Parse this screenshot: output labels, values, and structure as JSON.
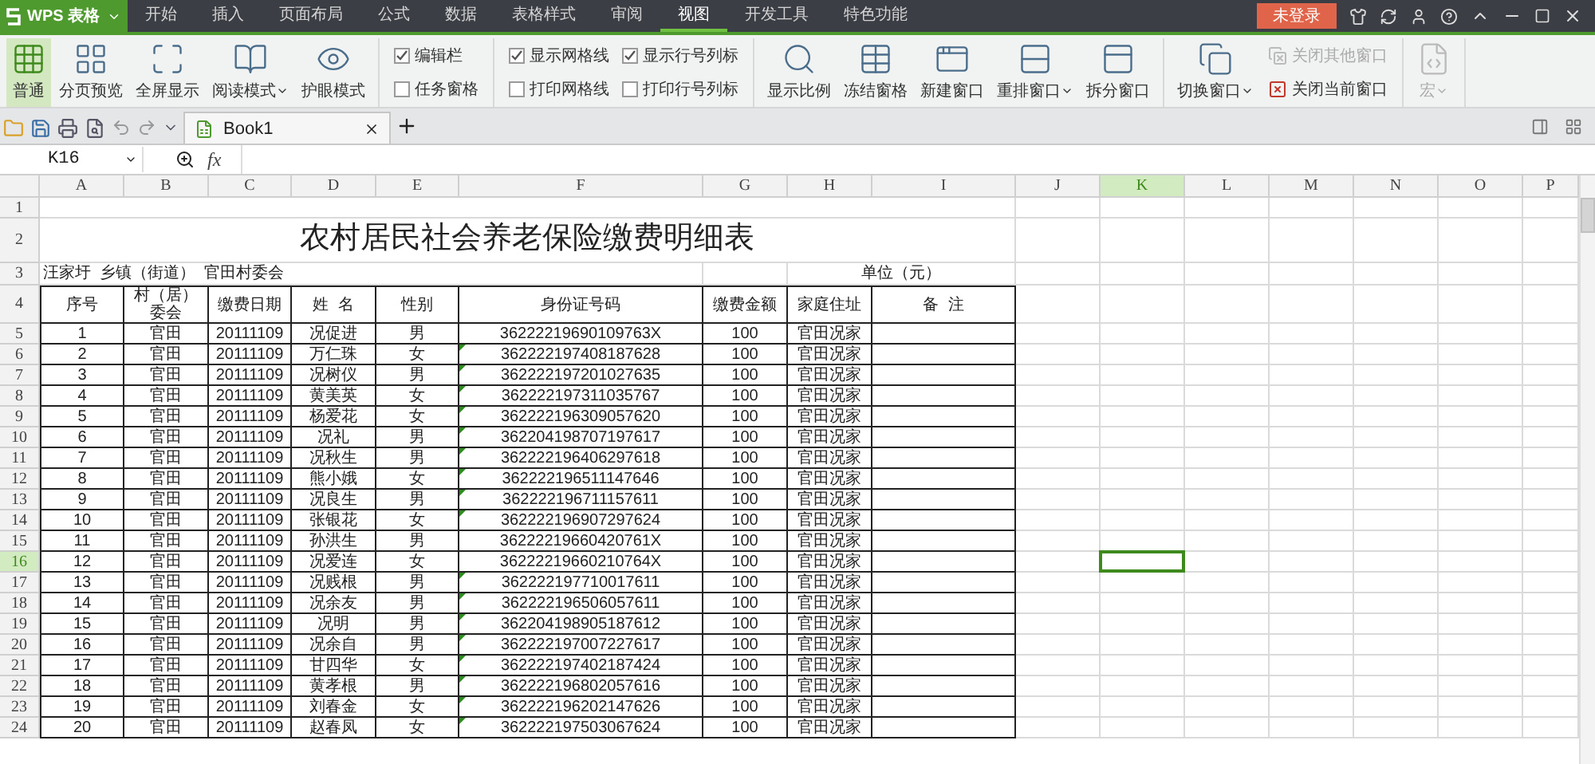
{
  "menu": {
    "app": "WPS 表格",
    "tabs": [
      {
        "label": "开始",
        "selected": false
      },
      {
        "label": "插入",
        "selected": false
      },
      {
        "label": "页面布局",
        "selected": false
      },
      {
        "label": "公式",
        "selected": false
      },
      {
        "label": "数据",
        "selected": false
      },
      {
        "label": "表格样式",
        "selected": false
      },
      {
        "label": "审阅",
        "selected": false
      },
      {
        "label": "视图",
        "selected": true
      },
      {
        "label": "开发工具",
        "selected": false
      },
      {
        "label": "特色功能",
        "selected": false
      }
    ],
    "login": "未登录"
  },
  "ribbon": {
    "groups": [
      {
        "items": [
          {
            "kind": "large",
            "label": "普通",
            "selected": true,
            "dropdown": false,
            "disabled": false
          },
          {
            "kind": "large",
            "label": "分页预览",
            "selected": false,
            "dropdown": false,
            "disabled": false
          },
          {
            "kind": "large",
            "label": "全屏显示",
            "selected": false,
            "dropdown": false,
            "disabled": false
          },
          {
            "kind": "large",
            "label": "阅读模式",
            "selected": false,
            "dropdown": true,
            "disabled": false
          },
          {
            "kind": "large",
            "label": "护眼模式",
            "selected": false,
            "dropdown": false,
            "disabled": false
          }
        ]
      },
      {
        "items": [
          {
            "kind": "check",
            "label": "编辑栏",
            "checked": true
          },
          {
            "kind": "check",
            "label": "任务窗格",
            "checked": false
          }
        ]
      },
      {
        "items": [
          {
            "kind": "check",
            "label": "显示网格线",
            "checked": true
          },
          {
            "kind": "check",
            "label": "打印网格线",
            "checked": false
          },
          {
            "kind": "check",
            "label": "显示行号列标",
            "checked": true
          },
          {
            "kind": "check",
            "label": "打印行号列标",
            "checked": false
          }
        ]
      },
      {
        "items": [
          {
            "kind": "large",
            "label": "显示比例",
            "selected": false,
            "dropdown": false,
            "disabled": false
          },
          {
            "kind": "large",
            "label": "冻结窗格",
            "selected": false,
            "dropdown": false,
            "disabled": false
          },
          {
            "kind": "large",
            "label": "新建窗口",
            "selected": false,
            "dropdown": false,
            "disabled": false
          },
          {
            "kind": "large",
            "label": "重排窗口",
            "selected": false,
            "dropdown": true,
            "disabled": false
          },
          {
            "kind": "large",
            "label": "拆分窗口",
            "selected": false,
            "dropdown": false,
            "disabled": false
          }
        ]
      },
      {
        "items": [
          {
            "kind": "large",
            "label": "切换窗口",
            "selected": false,
            "dropdown": true,
            "disabled": false
          },
          {
            "kind": "small",
            "label": "关闭其他窗口",
            "disabled": true
          },
          {
            "kind": "small",
            "label": "关闭当前窗口",
            "disabled": false
          }
        ]
      },
      {
        "items": [
          {
            "kind": "large",
            "label": "宏",
            "selected": false,
            "dropdown": true,
            "disabled": true
          }
        ]
      }
    ]
  },
  "doc_tabs": [
    {
      "label": "Book1",
      "selected": true
    }
  ],
  "formula_bar": {
    "name_box": "K16",
    "fx": "fx"
  },
  "sheet": {
    "columns": [
      {
        "label": "A",
        "selected": false
      },
      {
        "label": "B",
        "selected": false
      },
      {
        "label": "C",
        "selected": false
      },
      {
        "label": "D",
        "selected": false
      },
      {
        "label": "E",
        "selected": false
      },
      {
        "label": "F",
        "selected": false
      },
      {
        "label": "G",
        "selected": false
      },
      {
        "label": "H",
        "selected": false
      },
      {
        "label": "I",
        "selected": false
      },
      {
        "label": "J",
        "selected": false
      },
      {
        "label": "K",
        "selected": true
      },
      {
        "label": "L",
        "selected": false
      },
      {
        "label": "M",
        "selected": false
      },
      {
        "label": "N",
        "selected": false
      },
      {
        "label": "O",
        "selected": false
      },
      {
        "label": "P",
        "selected": false
      }
    ],
    "row_numbers": [
      {
        "label": "1",
        "selected": false
      },
      {
        "label": "2",
        "selected": false
      },
      {
        "label": "3",
        "selected": false
      },
      {
        "label": "4",
        "selected": false
      },
      {
        "label": "5",
        "selected": false
      },
      {
        "label": "6",
        "selected": false
      },
      {
        "label": "7",
        "selected": false
      },
      {
        "label": "8",
        "selected": false
      },
      {
        "label": "9",
        "selected": false
      },
      {
        "label": "10",
        "selected": false
      },
      {
        "label": "11",
        "selected": false
      },
      {
        "label": "12",
        "selected": false
      },
      {
        "label": "13",
        "selected": false
      },
      {
        "label": "14",
        "selected": false
      },
      {
        "label": "15",
        "selected": false
      },
      {
        "label": "16",
        "selected": true
      },
      {
        "label": "17",
        "selected": false
      },
      {
        "label": "18",
        "selected": false
      },
      {
        "label": "19",
        "selected": false
      },
      {
        "label": "20",
        "selected": false
      },
      {
        "label": "21",
        "selected": false
      },
      {
        "label": "22",
        "selected": false
      },
      {
        "label": "23",
        "selected": false
      },
      {
        "label": "24",
        "selected": false
      }
    ],
    "title": "农村居民社会养老保险缴费明细表",
    "subtitle_left": "汪家圩  乡镇（街道）  官田村委会",
    "subtitle_right": "单位（元）",
    "header": [
      "序号",
      "村（居）委会",
      "缴费日期",
      "姓  名",
      "性别",
      "身份证号码",
      "缴费金额",
      "家庭住址",
      "备  注"
    ],
    "rows": [
      {
        "cells": [
          "1",
          "官田",
          "20111109",
          "况促进",
          "男",
          "36222219690109763X",
          "100",
          "官田况家"
        ],
        "flagged": false
      },
      {
        "cells": [
          "2",
          "官田",
          "20111109",
          "万仁珠",
          "女",
          "362222197408187628",
          "100",
          "官田况家"
        ],
        "flagged": true
      },
      {
        "cells": [
          "3",
          "官田",
          "20111109",
          "况树仪",
          "男",
          "362222197201027635",
          "100",
          "官田况家"
        ],
        "flagged": true
      },
      {
        "cells": [
          "4",
          "官田",
          "20111109",
          "黄美英",
          "女",
          "362222197311035767",
          "100",
          "官田况家"
        ],
        "flagged": true
      },
      {
        "cells": [
          "5",
          "官田",
          "20111109",
          "杨爱花",
          "女",
          "362222196309057620",
          "100",
          "官田况家"
        ],
        "flagged": true
      },
      {
        "cells": [
          "6",
          "官田",
          "20111109",
          "况礼",
          "男",
          "362204198707197617",
          "100",
          "官田况家"
        ],
        "flagged": true
      },
      {
        "cells": [
          "7",
          "官田",
          "20111109",
          "况秋生",
          "男",
          "362222196406297618",
          "100",
          "官田况家"
        ],
        "flagged": true
      },
      {
        "cells": [
          "8",
          "官田",
          "20111109",
          "熊小娥",
          "女",
          "362222196511147646",
          "100",
          "官田况家"
        ],
        "flagged": true
      },
      {
        "cells": [
          "9",
          "官田",
          "20111109",
          "况良生",
          "男",
          "362222196711157611",
          "100",
          "官田况家"
        ],
        "flagged": true
      },
      {
        "cells": [
          "10",
          "官田",
          "20111109",
          "张银花",
          "女",
          "362222196907297624",
          "100",
          "官田况家"
        ],
        "flagged": true
      },
      {
        "cells": [
          "11",
          "官田",
          "20111109",
          "孙洪生",
          "男",
          "36222219660420761X",
          "100",
          "官田况家"
        ],
        "flagged": false
      },
      {
        "cells": [
          "12",
          "官田",
          "20111109",
          "况爱连",
          "女",
          "36222219660210764X",
          "100",
          "官田况家"
        ],
        "flagged": false
      },
      {
        "cells": [
          "13",
          "官田",
          "20111109",
          "况贱根",
          "男",
          "362222197710017611",
          "100",
          "官田况家"
        ],
        "flagged": true
      },
      {
        "cells": [
          "14",
          "官田",
          "20111109",
          "况余友",
          "男",
          "362222196506057611",
          "100",
          "官田况家"
        ],
        "flagged": true
      },
      {
        "cells": [
          "15",
          "官田",
          "20111109",
          "况明",
          "男",
          "362204198905187612",
          "100",
          "官田况家"
        ],
        "flagged": true
      },
      {
        "cells": [
          "16",
          "官田",
          "20111109",
          "况余自",
          "男",
          "362222197007227617",
          "100",
          "官田况家"
        ],
        "flagged": true
      },
      {
        "cells": [
          "17",
          "官田",
          "20111109",
          "甘四华",
          "女",
          "362222197402187424",
          "100",
          "官田况家"
        ],
        "flagged": true
      },
      {
        "cells": [
          "18",
          "官田",
          "20111109",
          "黄孝根",
          "男",
          "362222196802057616",
          "100",
          "官田况家"
        ],
        "flagged": true
      },
      {
        "cells": [
          "19",
          "官田",
          "20111109",
          "刘春金",
          "女",
          "362222196202147626",
          "100",
          "官田况家"
        ],
        "flagged": true
      },
      {
        "cells": [
          "20",
          "官田",
          "20111109",
          "赵春凤",
          "女",
          "362222197503067624",
          "100",
          "官田况家"
        ],
        "flagged": true
      }
    ]
  }
}
